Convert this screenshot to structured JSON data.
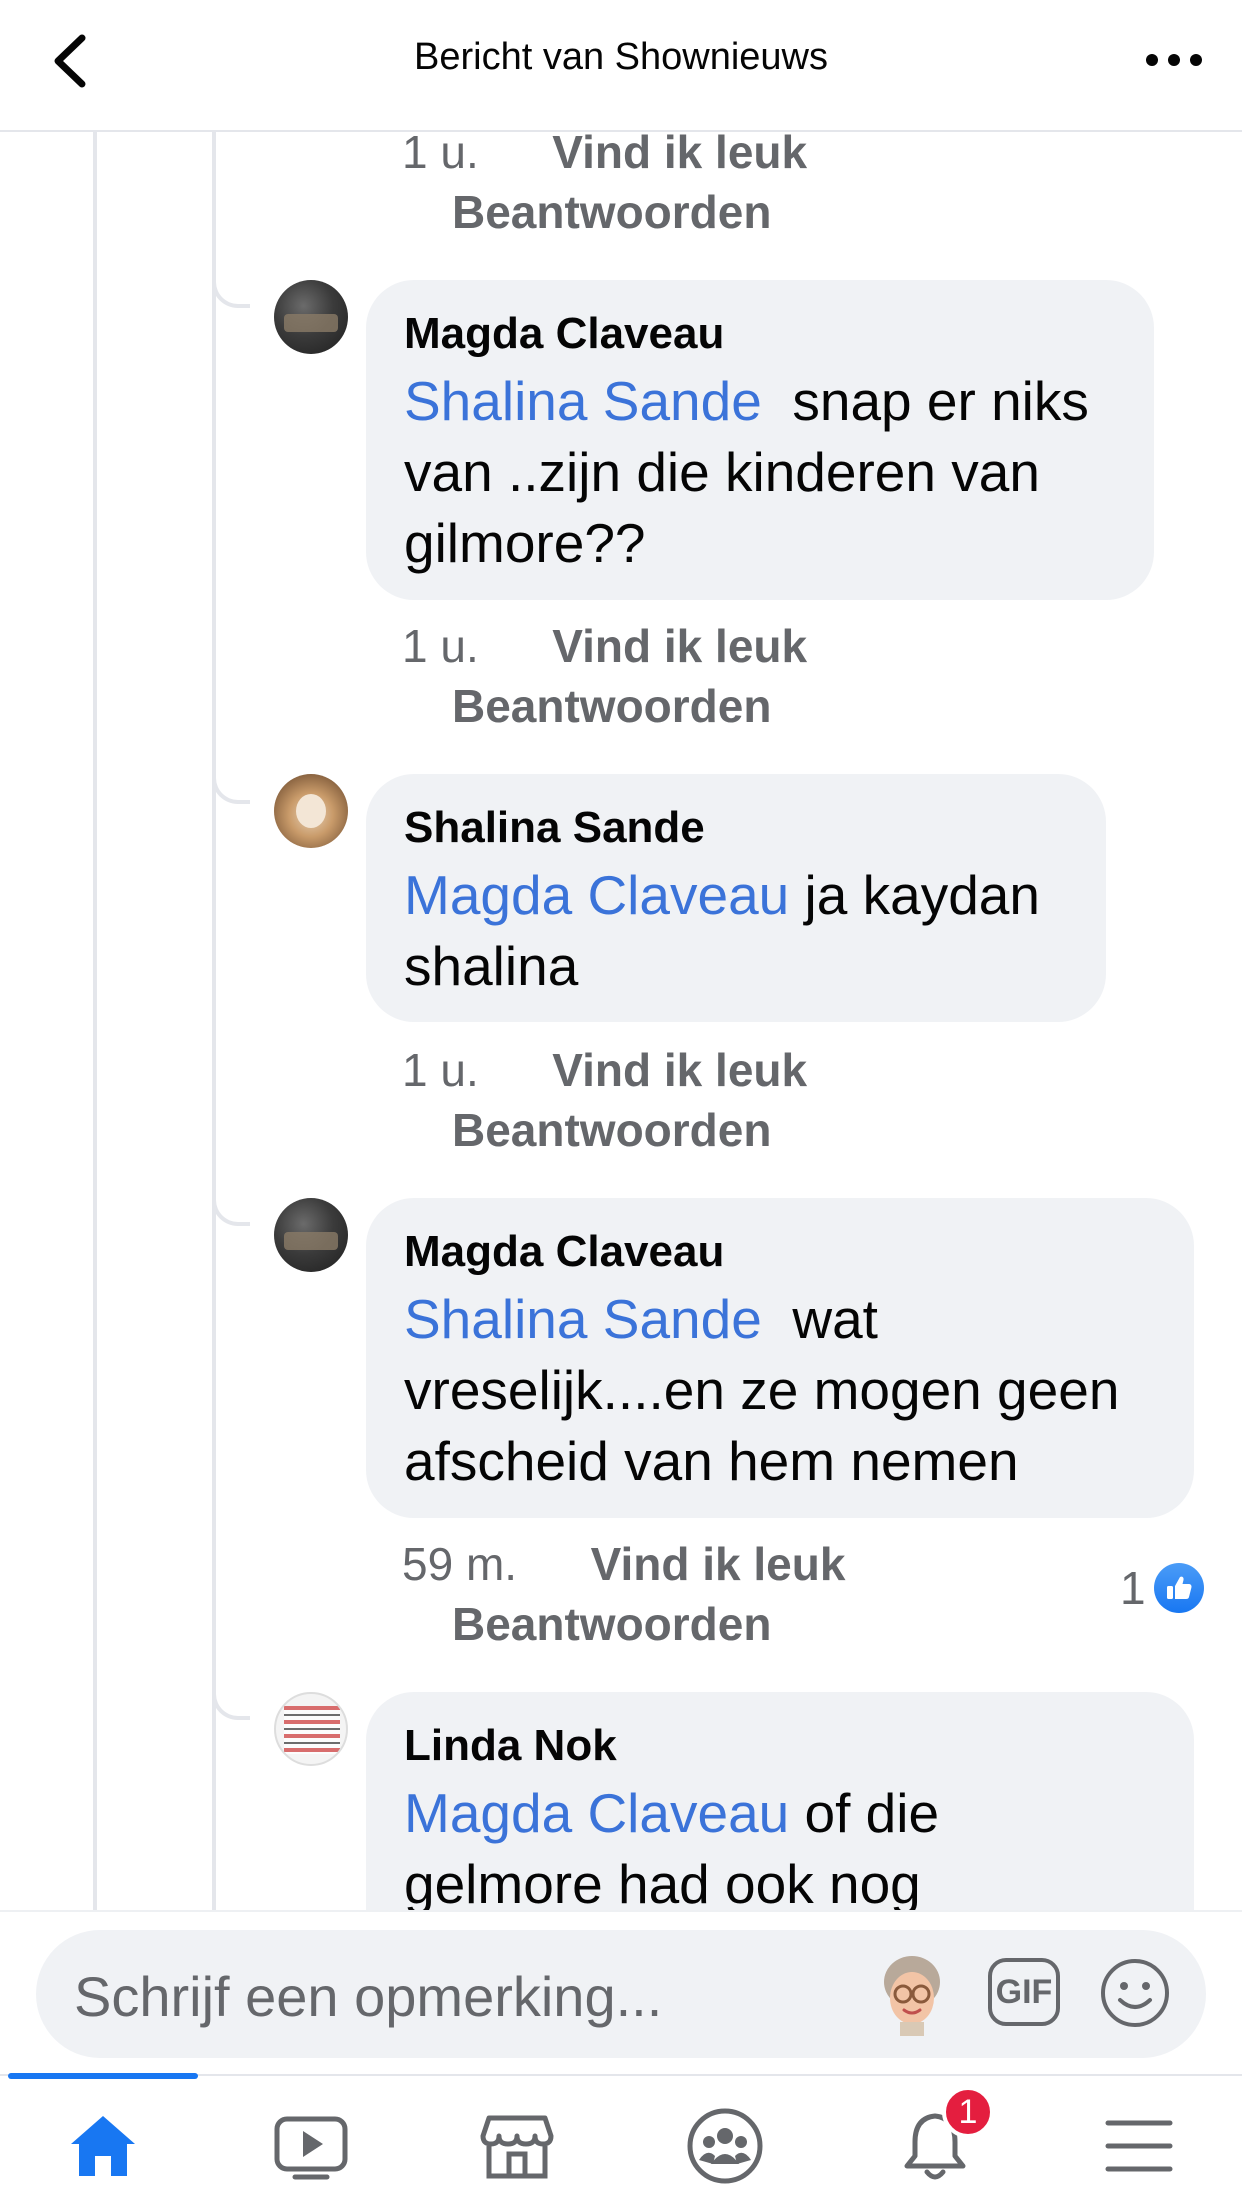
{
  "header": {
    "title": "Bericht van Shownieuws"
  },
  "comments": [
    {
      "time": "1 u.",
      "like_label": "Vind ik leuk",
      "reply_label": "Beantwoorden"
    },
    {
      "author": "Magda Claveau",
      "mention": "Shalina Sande",
      "text_lines": [
        "snap er niks",
        "van ..zijn die kinderen van",
        "gilmore??"
      ],
      "time": "1 u.",
      "like_label": "Vind ik leuk",
      "reply_label": "Beantwoorden"
    },
    {
      "author": "Shalina Sande",
      "mention": "Magda Claveau",
      "text_lines": [
        "ja kaydan",
        "shalina"
      ],
      "time": "1 u.",
      "like_label": "Vind ik leuk",
      "reply_label": "Beantwoorden"
    },
    {
      "author": "Magda Claveau",
      "mention": "Shalina Sande",
      "text_lines": [
        "wat",
        "vreselijk....en ze mogen geen",
        "afscheid van hem nemen"
      ],
      "time": "59 m.",
      "like_label": "Vind ik leuk",
      "reply_label": "Beantwoorden",
      "reaction_count": "1"
    },
    {
      "author": "Linda Nok",
      "mention": "Magda Claveau",
      "text_lines": [
        "of die",
        "gelmore had ook nog"
      ]
    }
  ],
  "composer": {
    "placeholder": "Schrijf een opmerking...",
    "gif_label": "GIF"
  },
  "tabbar": {
    "tabs": [
      "home-icon",
      "watch-icon",
      "marketplace-icon",
      "groups-icon",
      "notifications-icon",
      "menu-icon"
    ],
    "notification_count": "1"
  },
  "colors": {
    "accent": "#1877f2",
    "mention": "#3b73d9",
    "bubble": "#f0f2f5",
    "secondary_text": "#65676b",
    "badge": "#e41e3f"
  }
}
